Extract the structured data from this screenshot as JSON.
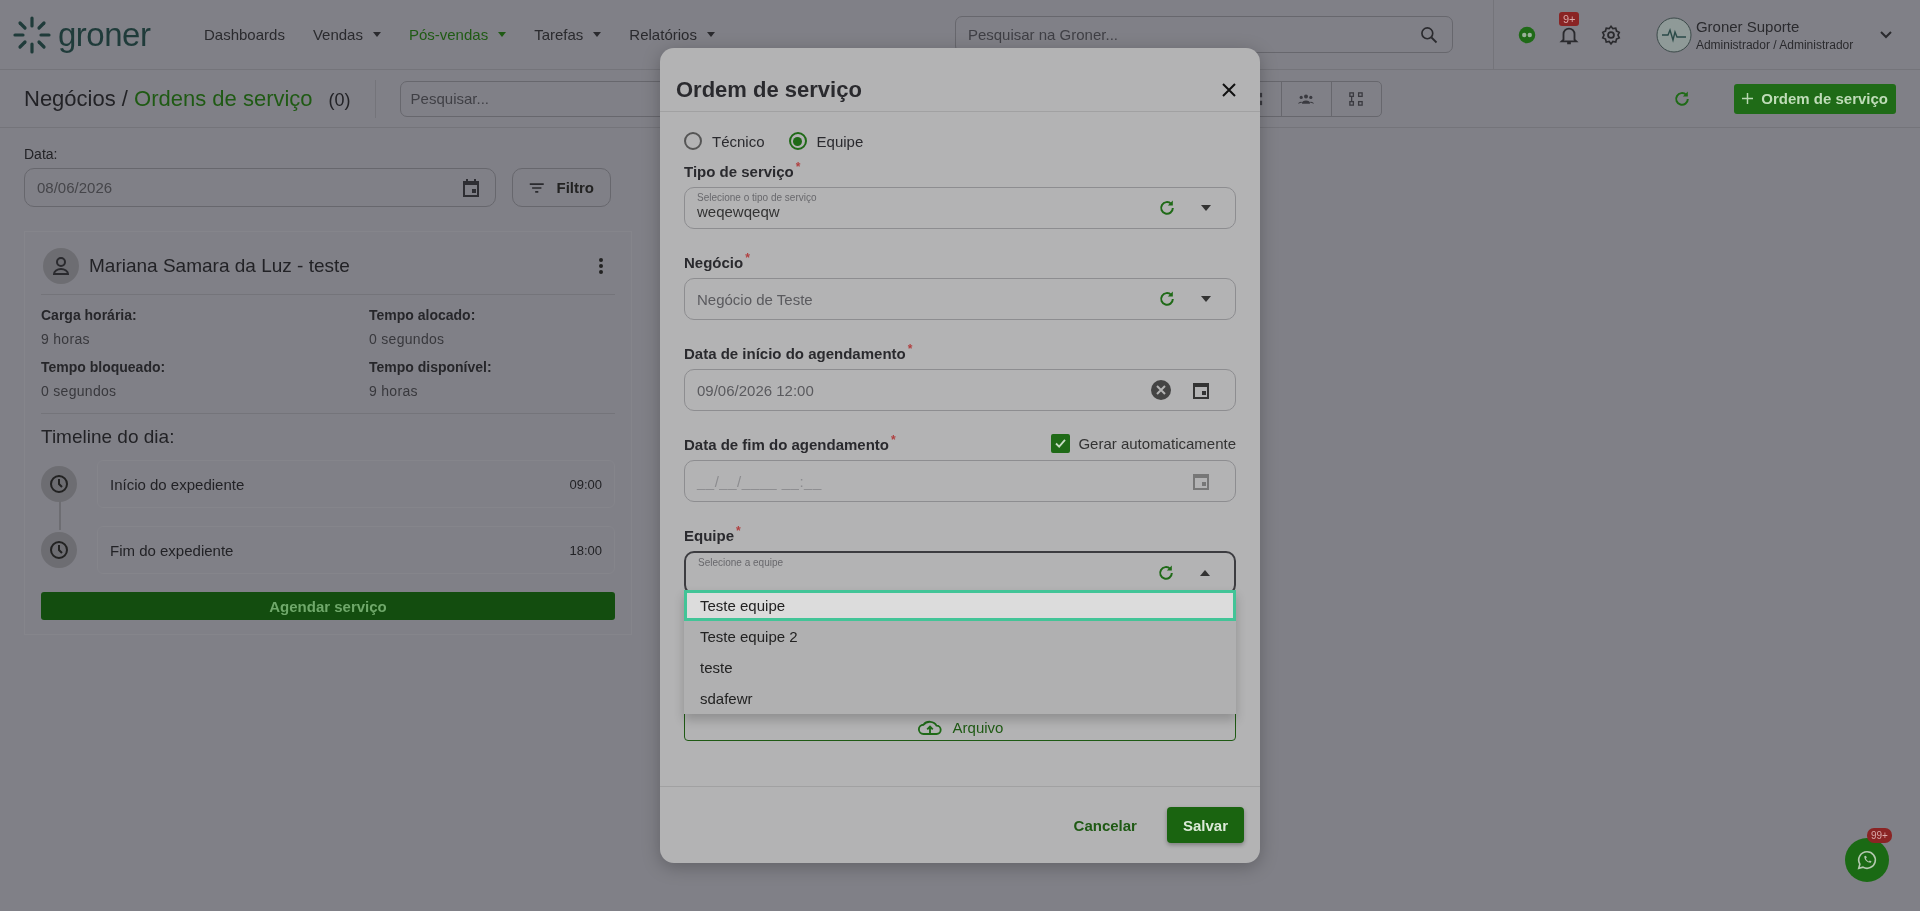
{
  "header": {
    "logo": "groner",
    "nav": [
      {
        "label": "Dashboards",
        "dropdown": false,
        "selected": false
      },
      {
        "label": "Vendas",
        "dropdown": true,
        "selected": false
      },
      {
        "label": "Pós-vendas",
        "dropdown": true,
        "selected": true
      },
      {
        "label": "Tarefas",
        "dropdown": true,
        "selected": false
      },
      {
        "label": "Relatórios",
        "dropdown": true,
        "selected": false
      }
    ],
    "search": {
      "placeholder": "Pesquisar na Groner..."
    },
    "notifications_badge": "9+",
    "user": {
      "name": "Groner Suporte",
      "role": "Administrador / Administrador"
    }
  },
  "toolbar": {
    "breadcrumb_root": "Negócios / ",
    "breadcrumb_current": "Ordens de serviço",
    "count": "(0)",
    "search": {
      "placeholder": "Pesquisar..."
    },
    "new_button": "Ordem de serviço"
  },
  "filter": {
    "label": "Data:",
    "date": "08/06/2026",
    "button": "Filtro"
  },
  "card": {
    "name": "Mariana Samara da Luz - teste",
    "stats": [
      {
        "label": "Carga horária:",
        "value": "9 horas"
      },
      {
        "label": "Tempo alocado:",
        "value": "0 segundos"
      },
      {
        "label": "Tempo bloqueado:",
        "value": "0 segundos"
      },
      {
        "label": "Tempo disponível:",
        "value": "9 horas"
      }
    ],
    "timeline_title": "Timeline do dia:",
    "timeline": [
      {
        "label": "Início do expediente",
        "time": "09:00"
      },
      {
        "label": "Fim do expediente",
        "time": "18:00"
      }
    ],
    "button": "Agendar serviço"
  },
  "modal": {
    "title": "Ordem de serviço",
    "radios": [
      {
        "label": "Técnico",
        "selected": false
      },
      {
        "label": "Equipe",
        "selected": true
      }
    ],
    "fields": [
      {
        "kind": "select",
        "label": "Tipo de serviço",
        "required_mark": "*",
        "floating_label": "Selecione o tipo de serviço",
        "value": "weqewqeqw",
        "open": false
      },
      {
        "kind": "select",
        "label": "Negócio",
        "required_mark": "*",
        "value": "Negócio de Teste",
        "open": false
      },
      {
        "kind": "date",
        "label": "Data de início do agendamento",
        "required_mark": "*",
        "value": "09/06/2026 12:00",
        "clearable": true
      },
      {
        "kind": "date",
        "label": "Data de fim do agendamento",
        "required_mark": "*",
        "placeholder": "__/__/____ __:__",
        "clearable": false,
        "auto": {
          "label": "Gerar automaticamente",
          "checked": true
        }
      },
      {
        "kind": "select",
        "label": "Equipe",
        "required_mark": "*",
        "floating_label": "Selecione a equipe",
        "open": true,
        "options": [
          {
            "label": "Teste equipe",
            "selected": true
          },
          {
            "label": "Teste equipe 2",
            "selected": false
          },
          {
            "label": "teste",
            "selected": false
          },
          {
            "label": "sdafewr",
            "selected": false
          }
        ]
      }
    ],
    "upload_button": "Arquivo",
    "cancel": "Cancelar",
    "save": "Salvar"
  },
  "whatsapp": {
    "badge": "99+"
  }
}
